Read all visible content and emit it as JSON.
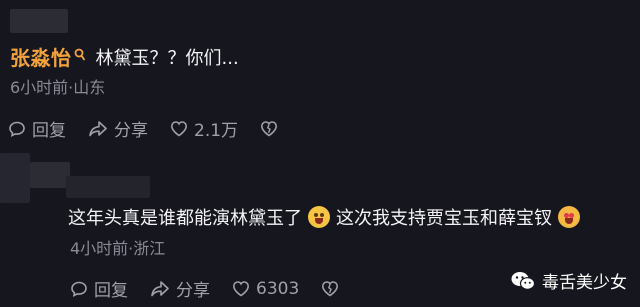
{
  "comments": [
    {
      "username": "张淼怡",
      "text": "林黛玉？？你们...",
      "meta": "6小时前·山东",
      "reply_label": "回复",
      "share_label": "分享",
      "like_count": "2.1万"
    },
    {
      "text_a": "这年头真是谁都能演林黛玉了",
      "text_b": "这次我支持贾宝玉和薛宝钗",
      "meta": "4小时前·浙江",
      "reply_label": "回复",
      "share_label": "分享",
      "like_count": "6303"
    }
  ],
  "watermark": {
    "text": "毒舌美少女"
  },
  "colors": {
    "background": "#16161e",
    "username": "#f4a23c",
    "meta": "#8a8a96"
  }
}
